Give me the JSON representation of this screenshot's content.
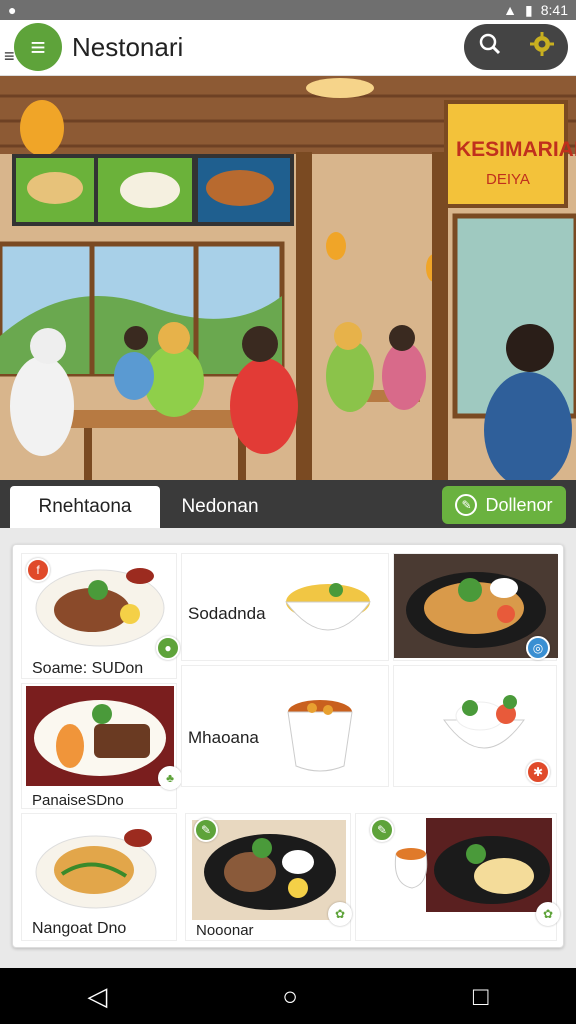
{
  "status": {
    "time": "8:41"
  },
  "appbar": {
    "title": "Nestonari",
    "menu_icon": "hamburger-icon",
    "search_icon": "search-icon",
    "settings_icon": "gear-icon"
  },
  "hero": {
    "sign_main": "KESIMARIAN",
    "sign_sub": "DEIYA"
  },
  "tabs": [
    {
      "label": "Rnehtaona"
    },
    {
      "label": "Nedonan"
    }
  ],
  "cta": {
    "label": "Dollenor"
  },
  "menu": {
    "row1": {
      "item1": "Soame: SUDon",
      "item2": "Sodadnda"
    },
    "row2": {
      "item1": "PanaiseSDno",
      "item2": "Mhaoana"
    },
    "row3": {
      "item1": "Nangoat Dno",
      "item2": "Nooonar"
    }
  },
  "colors": {
    "accent": "#5ea33a",
    "cta": "#6ab23f",
    "tabbar": "#3a3a3a"
  }
}
